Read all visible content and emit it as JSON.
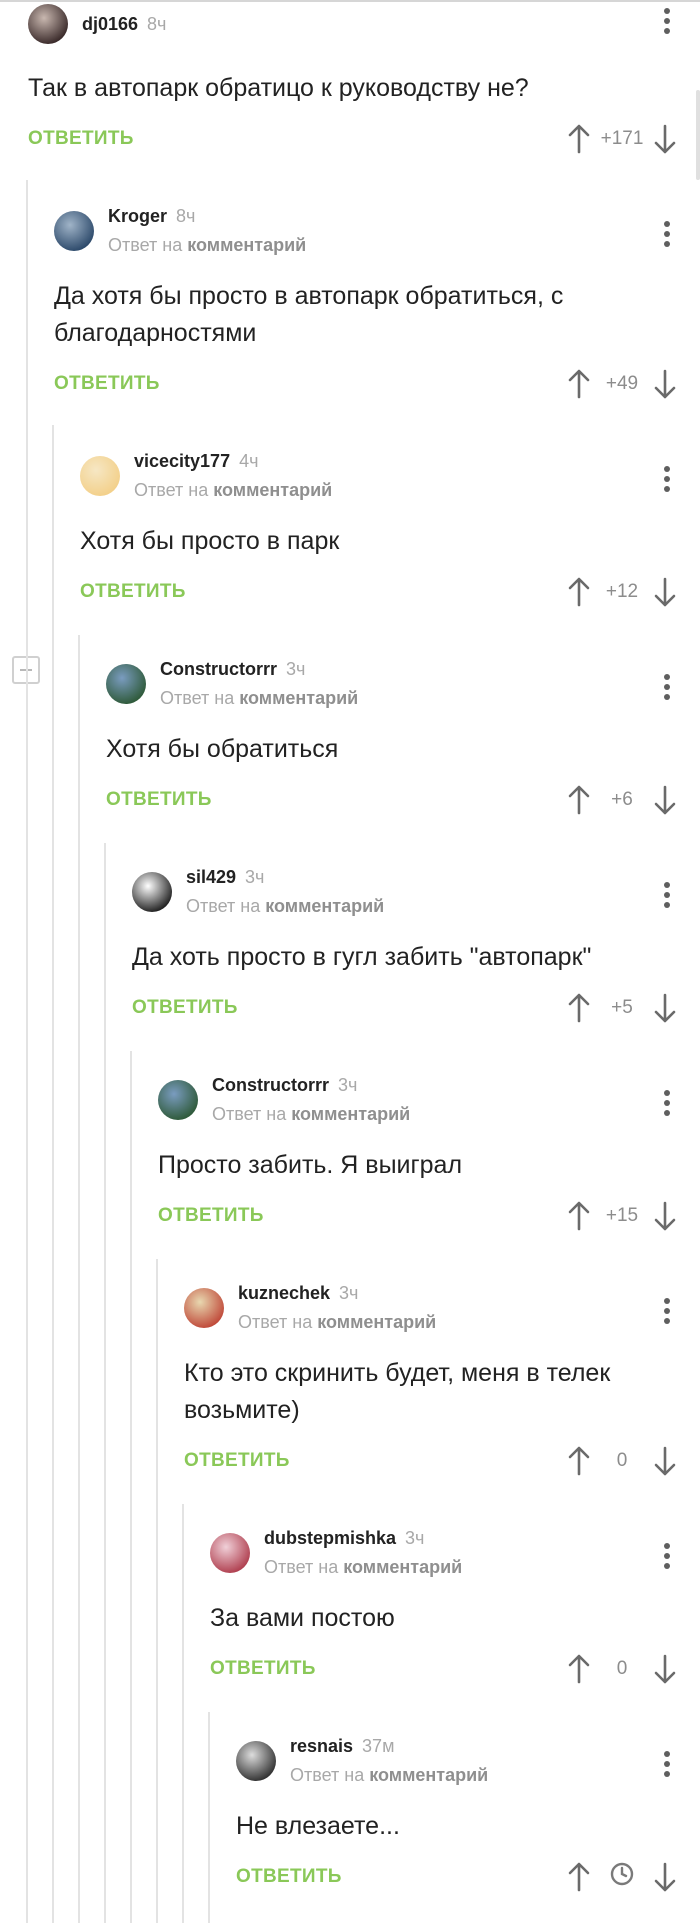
{
  "comments": [
    {
      "user": "dj0166",
      "time": "8ч",
      "reply_prefix": "",
      "reply_link": "",
      "text": "Так в автопарк обратицо к руководству не?",
      "reply_label": "ОТВЕТИТЬ",
      "rating": "+171",
      "avatar_colors": [
        "#3a2a2a",
        "#c9b8b0"
      ]
    },
    {
      "user": "Kroger",
      "time": "8ч",
      "reply_prefix": "Ответ на",
      "reply_link": "комментарий",
      "text": "Да хотя бы просто в автопарк обратиться, с благодарностями",
      "reply_label": "ОТВЕТИТЬ",
      "rating": "+49",
      "avatar_colors": [
        "#2d4a6b",
        "#a0b4c8"
      ]
    },
    {
      "user": "vicecity177",
      "time": "4ч",
      "reply_prefix": "Ответ на",
      "reply_link": "комментарий",
      "text": "Хотя бы просто в парк",
      "reply_label": "ОТВЕТИТЬ",
      "rating": "+12",
      "avatar_colors": [
        "#f3d08a",
        "#f6e7c4"
      ]
    },
    {
      "user": "Constructorrr",
      "time": "3ч",
      "reply_prefix": "Ответ на",
      "reply_link": "комментарий",
      "text": "Хотя бы обратиться",
      "reply_label": "ОТВЕТИТЬ",
      "rating": "+6",
      "avatar_colors": [
        "#2f5a3a",
        "#7a9cc0"
      ]
    },
    {
      "user": "sil429",
      "time": "3ч",
      "reply_prefix": "Ответ на",
      "reply_link": "комментарий",
      "text": "Да хоть просто в гугл забить \"автопарк\"",
      "reply_label": "ОТВЕТИТЬ",
      "rating": "+5",
      "avatar_colors": [
        "#222222",
        "#ffffff"
      ]
    },
    {
      "user": "Constructorrr",
      "time": "3ч",
      "reply_prefix": "Ответ на",
      "reply_link": "комментарий",
      "text": "Просто забить. Я выиграл",
      "reply_label": "ОТВЕТИТЬ",
      "rating": "+15",
      "avatar_colors": [
        "#2f5a3a",
        "#7a9cc0"
      ]
    },
    {
      "user": "kuznechek",
      "time": "3ч",
      "reply_prefix": "Ответ на",
      "reply_link": "комментарий",
      "text": "Кто это скринить будет, меня в телек возьмите)",
      "reply_label": "ОТВЕТИТЬ",
      "rating": "0",
      "avatar_colors": [
        "#c04a3a",
        "#e8d8b0"
      ]
    },
    {
      "user": "dubstepmishka",
      "time": "3ч",
      "reply_prefix": "Ответ на",
      "reply_link": "комментарий",
      "text": "За вами постою",
      "reply_label": "ОТВЕТИТЬ",
      "rating": "0",
      "avatar_colors": [
        "#b04050",
        "#f0d0d8"
      ]
    },
    {
      "user": "resnais",
      "time": "37м",
      "reply_prefix": "Ответ на",
      "reply_link": "комментарий",
      "text": "Не влезаете...",
      "reply_label": "ОТВЕТИТЬ",
      "rating": "",
      "rating_icon": "clock-icon",
      "avatar_colors": [
        "#333333",
        "#dddddd"
      ]
    }
  ],
  "colors": {
    "accent_green": "#8ac858",
    "muted_text": "#a8a8a8",
    "thread_line": "#e3e3e3"
  }
}
